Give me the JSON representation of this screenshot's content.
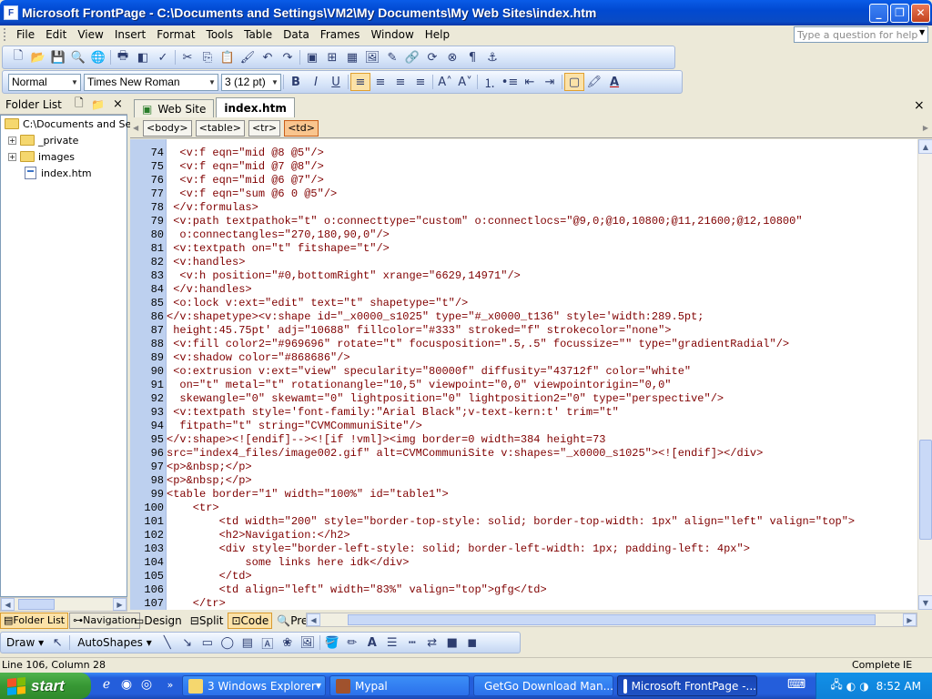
{
  "window": {
    "title": "Microsoft FrontPage - C:\\Documents and Settings\\VM2\\My Documents\\My Web Sites\\index.htm",
    "app_icon_letter": "F"
  },
  "menu": {
    "items": [
      "File",
      "Edit",
      "View",
      "Insert",
      "Format",
      "Tools",
      "Table",
      "Data",
      "Frames",
      "Window",
      "Help"
    ],
    "ask_placeholder": "Type a question for help"
  },
  "formatting": {
    "style": "Normal",
    "font": "Times New Roman",
    "size": "3 (12 pt)"
  },
  "folder_list": {
    "title": "Folder List",
    "root": "C:\\Documents and Setti",
    "items": [
      "_private",
      "images",
      "index.htm"
    ]
  },
  "bottom_tabs": {
    "folder_list": "Folder List",
    "navigation": "Navigation"
  },
  "doc_tabs": {
    "web_site": "Web Site",
    "index": "index.htm",
    "close": "×"
  },
  "quick_tags": [
    "<body>",
    "<table>",
    "<tr>",
    "<td>"
  ],
  "code": {
    "line_numbers": [
      "74",
      "75",
      "76",
      "77",
      "78",
      "79",
      "80",
      "81",
      "82",
      "83",
      "84",
      "85",
      "86",
      "87",
      "88",
      "89",
      "90",
      "91",
      "92",
      "93",
      "94",
      "95",
      "96",
      "97",
      "98",
      "99",
      "100",
      "101",
      "102",
      "103",
      "104",
      "105",
      "106",
      "107"
    ],
    "lines": [
      "  <v:f eqn=\"mid @8 @5\"/>",
      "  <v:f eqn=\"mid @7 @8\"/>",
      "  <v:f eqn=\"mid @6 @7\"/>",
      "  <v:f eqn=\"sum @6 0 @5\"/>",
      " </v:formulas>",
      " <v:path textpathok=\"t\" o:connecttype=\"custom\" o:connectlocs=\"@9,0;@10,10800;@11,21600;@12,10800\"",
      "  o:connectangles=\"270,180,90,0\"/>",
      " <v:textpath on=\"t\" fitshape=\"t\"/>",
      " <v:handles>",
      "  <v:h position=\"#0,bottomRight\" xrange=\"6629,14971\"/>",
      " </v:handles>",
      " <o:lock v:ext=\"edit\" text=\"t\" shapetype=\"t\"/>",
      "</v:shapetype><v:shape id=\"_x0000_s1025\" type=\"#_x0000_t136\" style='width:289.5pt;",
      " height:45.75pt' adj=\"10688\" fillcolor=\"#333\" stroked=\"f\" strokecolor=\"none\">",
      " <v:fill color2=\"#969696\" rotate=\"t\" focusposition=\".5,.5\" focussize=\"\" type=\"gradientRadial\"/>",
      " <v:shadow color=\"#868686\"/>",
      " <o:extrusion v:ext=\"view\" specularity=\"80000f\" diffusity=\"43712f\" color=\"white\"",
      "  on=\"t\" metal=\"t\" rotationangle=\"10,5\" viewpoint=\"0,0\" viewpointorigin=\"0,0\"",
      "  skewangle=\"0\" skewamt=\"0\" lightposition=\"0\" lightposition2=\"0\" type=\"perspective\"/>",
      " <v:textpath style='font-family:\"Arial Black\";v-text-kern:t' trim=\"t\"",
      "  fitpath=\"t\" string=\"CVMCommuniSite\"/>",
      "</v:shape><![endif]--><![if !vml]><img border=0 width=384 height=73",
      "src=\"index4_files/image002.gif\" alt=CVMCommuniSite v:shapes=\"_x0000_s1025\"><![endif]></div>",
      "<p>&nbsp;</p>",
      "<p>&nbsp;</p>",
      "<table border=\"1\" width=\"100%\" id=\"table1\">",
      "    <tr>",
      "        <td width=\"200\" style=\"border-top-style: solid; border-top-width: 1px\" align=\"left\" valign=\"top\">",
      "        <h2>Navigation:</h2>",
      "        <div style=\"border-left-style: solid; border-left-width: 1px; padding-left: 4px\">",
      "            some links here idk</div>",
      "        </td>",
      "        <td align=\"left\" width=\"83%\" valign=\"top\">gfg</td>",
      "    </tr>"
    ]
  },
  "view_tabs": {
    "design": "Design",
    "split": "Split",
    "code": "Code",
    "preview": "Preview"
  },
  "drawing": {
    "draw": "Draw",
    "autoshapes": "AutoShapes"
  },
  "status": {
    "position": "Line 106, Column 28",
    "state": "Complete",
    "browser": "IE"
  },
  "taskbar": {
    "start": "start",
    "tasks": [
      "3 Windows Explorer",
      "Mypal",
      "GetGo Download Man...",
      "Microsoft FrontPage -..."
    ],
    "clock": "8:52 AM"
  }
}
